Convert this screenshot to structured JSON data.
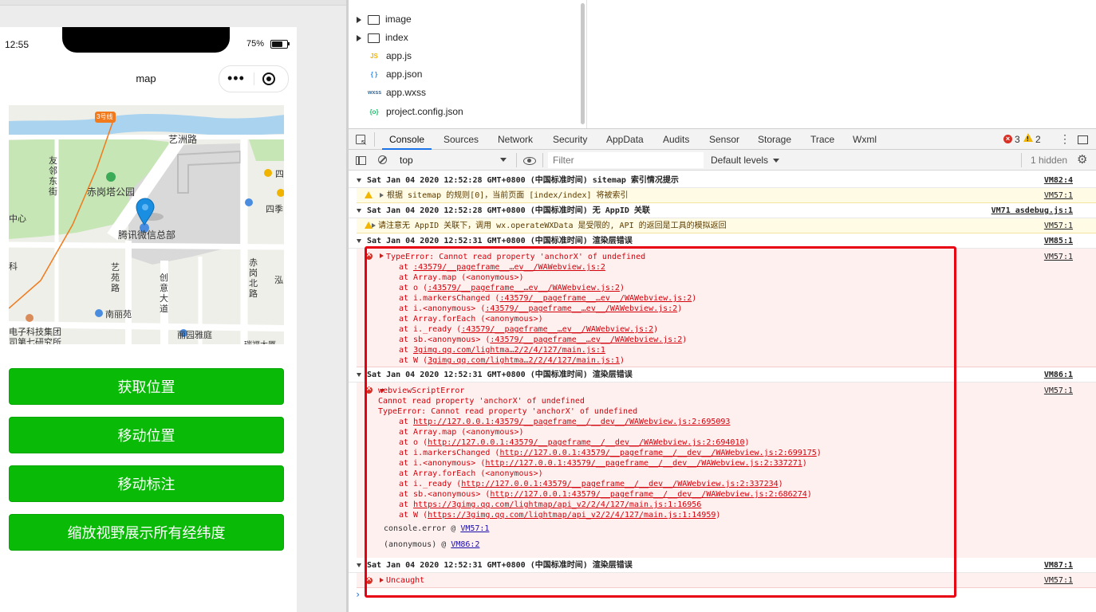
{
  "phone": {
    "time": "12:55",
    "battery": "75%",
    "nav_title": "map",
    "capsule_dots": "•••",
    "map": {
      "metro_label": "3号线",
      "street1": "艺洲路",
      "poi_park": "赤岗塔公园",
      "poi_tencent": "腾讯微信总部",
      "street_left": "友邻东街",
      "poi_left": "中心",
      "street_yiyuan": "艺苑路",
      "street_chuangyi": "创意大道",
      "street_chigang": "赤岗北路",
      "poi_nanliyuan": "南丽苑",
      "poi_liyuan": "丽园雅庭",
      "poi_electronic": "电子科技集团",
      "poi_research": "司第七研究所",
      "poi_bottom_right": "瑞福大厦",
      "poi_right1": "四",
      "poi_right2": "四季",
      "poi_hong": "泓",
      "poi_ke": "科"
    },
    "buttons": [
      "获取位置",
      "移动位置",
      "移动标注",
      "缩放视野展示所有经纬度"
    ]
  },
  "filetree": [
    {
      "type": "folder",
      "name": "image"
    },
    {
      "type": "folder",
      "name": "index"
    },
    {
      "type": "file",
      "icon": "JS",
      "name": "app.js",
      "color": "#f0b400"
    },
    {
      "type": "file",
      "icon": "{ }",
      "name": "app.json",
      "color": "#2d8cf0"
    },
    {
      "type": "file",
      "icon": "wxss",
      "name": "app.wxss",
      "color": "#2d6aa0"
    },
    {
      "type": "file",
      "icon": "{o}",
      "name": "project.config.json",
      "color": "#19be6b"
    }
  ],
  "devtools": {
    "tabs": [
      "Console",
      "Sources",
      "Network",
      "Security",
      "AppData",
      "Audits",
      "Sensor",
      "Storage",
      "Trace",
      "Wxml"
    ],
    "active_tab": "Console",
    "error_count": "3",
    "warning_count": "2",
    "context": "top",
    "filter_placeholder": "Filter",
    "levels": "Default levels",
    "hidden": "1 hidden",
    "accent_color": "#1a73e8",
    "error_color": "#d93025"
  },
  "console": {
    "g1": {
      "header": "Sat Jan 04 2020 12:52:28 GMT+0800 (中国标准时间) sitemap 索引情况提示",
      "src": "VM82:4"
    },
    "w1": {
      "text": "根据 sitemap 的规则[0]，当前页面 [index/index] 将被索引",
      "src": "VM57:1"
    },
    "g2": {
      "header": "Sat Jan 04 2020 12:52:28 GMT+0800 (中国标准时间) 无 AppID 关联",
      "src": "VM71 asdebug.js:1"
    },
    "w2": {
      "text": "请注意无 AppID 关联下，调用 wx.operateWXData 是受限的, API 的返回是工具的模拟返回",
      "src": "VM57:1"
    },
    "g3": {
      "header": "Sat Jan 04 2020 12:52:31 GMT+0800 (中国标准时间) 渲染层错误",
      "src": "VM85:1"
    },
    "e1": {
      "src": "VM57:1",
      "title": "TypeError: Cannot read property 'anchorX' of undefined",
      "frames": [
        {
          "pre": "at ",
          "link": ":43579/__pageframe__…ev__/WAWebview.js:2",
          "post": ""
        },
        {
          "pre": "at Array.map (<anonymous>)",
          "link": "",
          "post": ""
        },
        {
          "pre": "at o (",
          "link": ":43579/__pageframe__…ev__/WAWebview.js:2",
          "post": ")"
        },
        {
          "pre": "at i.markersChanged (",
          "link": ":43579/__pageframe__…ev__/WAWebview.js:2",
          "post": ")"
        },
        {
          "pre": "at i.<anonymous> (",
          "link": ":43579/__pageframe__…ev__/WAWebview.js:2",
          "post": ")"
        },
        {
          "pre": "at Array.forEach (<anonymous>)",
          "link": "",
          "post": ""
        },
        {
          "pre": "at i._ready (",
          "link": ":43579/__pageframe__…ev__/WAWebview.js:2",
          "post": ")"
        },
        {
          "pre": "at sb.<anonymous> (",
          "link": ":43579/__pageframe__…ev__/WAWebview.js:2",
          "post": ")"
        },
        {
          "pre": "at ",
          "link": "3gimg.qq.com/lightma…2/2/4/127/main.js:1",
          "post": ""
        },
        {
          "pre": "at W (",
          "link": "3gimg.qq.com/lightma…2/2/4/127/main.js:1",
          "post": ")"
        }
      ]
    },
    "g4": {
      "header": "Sat Jan 04 2020 12:52:31 GMT+0800 (中国标准时间) 渲染层错误",
      "src": "VM86:1"
    },
    "e2": {
      "src": "VM57:1",
      "title": "webviewScriptError",
      "line1": "Cannot read property 'anchorX' of undefined",
      "line2": "TypeError: Cannot read property 'anchorX' of undefined",
      "frames": [
        {
          "pre": "at ",
          "link": "http://127.0.0.1:43579/__pageframe__/__dev__/WAWebview.js:2:695093",
          "post": ""
        },
        {
          "pre": "at Array.map (<anonymous>)",
          "link": "",
          "post": ""
        },
        {
          "pre": "at o (",
          "link": "http://127.0.0.1:43579/__pageframe__/__dev__/WAWebview.js:2:694010",
          "post": ")"
        },
        {
          "pre": "at i.markersChanged (",
          "link": "http://127.0.0.1:43579/__pageframe__/__dev__/WAWebview.js:2:699175",
          "post": ")"
        },
        {
          "pre": "at i.<anonymous> (",
          "link": "http://127.0.0.1:43579/__pageframe__/__dev__/WAWebview.js:2:337271",
          "post": ")"
        },
        {
          "pre": "at Array.forEach (<anonymous>)",
          "link": "",
          "post": ""
        },
        {
          "pre": "at i._ready (",
          "link": "http://127.0.0.1:43579/__pageframe__/__dev__/WAWebview.js:2:337234",
          "post": ")"
        },
        {
          "pre": "at sb.<anonymous> (",
          "link": "http://127.0.0.1:43579/__pageframe__/__dev__/WAWebview.js:2:686274",
          "post": ")"
        },
        {
          "pre": "at ",
          "link": "https://3gimg.qq.com/lightmap/api_v2/2/4/127/main.js:1:16956",
          "post": ""
        },
        {
          "pre": "at W (",
          "link": "https://3gimg.qq.com/lightmap/api_v2/2/4/127/main.js:1:14959",
          "post": ")"
        }
      ],
      "trace1_pre": "console.error @ ",
      "trace1_link": "VM57:1",
      "trace2_pre": "(anonymous)   @ ",
      "trace2_link": "VM86:2"
    },
    "g5": {
      "header": "Sat Jan 04 2020 12:52:31 GMT+0800 (中国标准时间) 渲染层错误",
      "src": "VM87:1"
    },
    "e3": {
      "title": "Uncaught",
      "src": "VM57:1"
    },
    "prompt": "›"
  }
}
